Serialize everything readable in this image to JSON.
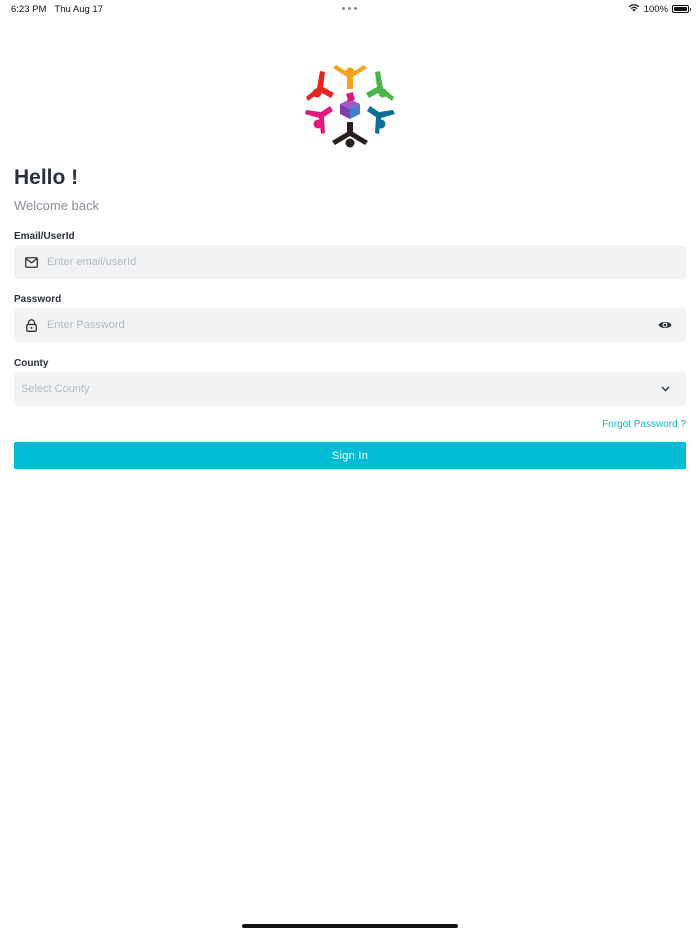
{
  "status_bar": {
    "time": "6:23 PM",
    "date": "Thu Aug 17",
    "battery": "100%"
  },
  "login": {
    "title": "Hello !",
    "subtitle": "Welcome back",
    "email": {
      "label": "Email/UserId",
      "placeholder": "Enter email/userId",
      "value": "",
      "icon": "mail-icon"
    },
    "password": {
      "label": "Password",
      "placeholder": "Enter Password",
      "value": "",
      "icon": "lock-icon",
      "toggle_icon": "eye-icon"
    },
    "county": {
      "label": "County",
      "placeholder": "Select County",
      "icon": "chevron-down-icon"
    },
    "forgot_password": "Forgot Password ?",
    "sign_in": "Sign In"
  },
  "colors": {
    "accent": "#00bcd4",
    "link": "#12b5cf",
    "field_bg": "#f2f3f5",
    "title": "#2a2f3b",
    "muted": "#8a8f99"
  }
}
